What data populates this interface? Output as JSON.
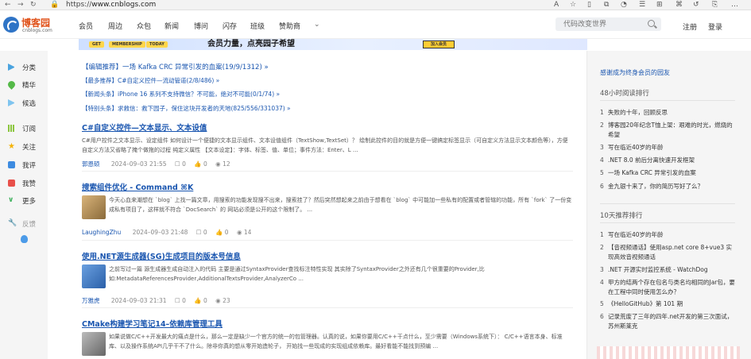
{
  "browser": {
    "url_scheme": "https://",
    "url_domain": "www.cnblogs.com"
  },
  "site": {
    "logo_name": "博客园",
    "logo_domain": "cnblogs.com",
    "nav": [
      "会员",
      "周边",
      "众包",
      "新闻",
      "博问",
      "闪存",
      "班级",
      "赞助商"
    ],
    "search_placeholder": "代码改变世界",
    "register": "注册",
    "login": "登录"
  },
  "banner": {
    "pills": [
      "GET",
      "MEMBERSHIP",
      "TODAY"
    ],
    "headline": "会员力量，点亮园子希望",
    "join": "加入会员"
  },
  "left_menu": [
    {
      "label": "分类",
      "icon": "triangle-play-icon"
    },
    {
      "label": "精华",
      "icon": "heart-icon"
    },
    {
      "label": "候选",
      "icon": "triangle-play-icon"
    },
    {
      "label": "订阅",
      "icon": "books-icon"
    },
    {
      "label": "关注",
      "icon": "star-icon"
    },
    {
      "label": "我评",
      "icon": "comment-icon"
    },
    {
      "label": "我赞",
      "icon": "thumbs-up-icon"
    },
    {
      "label": "更多",
      "icon": "chevron-down-icon"
    },
    {
      "label": "反馈",
      "icon": "wrench-icon"
    }
  ],
  "notices": [
    "【编辑推荐】一场 Kafka CRC 异常引发的血案(19/9/1312) »",
    "【最多推荐】C#自定义控件—流动管道(2/8/486) »",
    "【新闻头条】iPhone 16 系列不支持微信？不可能，绝对不可能(0/1/74) »",
    "【特别头条】求救信：救下园子，保住这块开发者的天地(825/556/331037) »"
  ],
  "posts": [
    {
      "title": "C#自定义控件—文本显示、文本设值",
      "summary": "C#用户控件之文本显示、设定组件 如何设计一个便捷的文本显示组件、文本设值组件（TextShow,TextSet）？ 绘制此控件的目的就是方便一键搞定标签显示（可自定义方法显示文本颜色等），方便自定义方法又省略了掩个做拖的过程 纯定义属性 【文本设定】：字体、标签、值、单位；事件方法：Enter、L ...",
      "author": "郭恩硕",
      "date": "2024–09–03 21:55",
      "comments": "0",
      "likes": "0",
      "views": "12",
      "thumb": false
    },
    {
      "title": "搜索组件优化 - Command ⌘K",
      "summary": "今天心血来潮想在 `blog` 上找一篇文章，用搜索的功能发现搜不出来，搜索挂了？然后突然想起来之前由于想看在 `blog` 中可能加一些私有的配置或者管辖的功能，所有 `fork` 了一份变成私有项目了，这样就不符合 `DocSearch` 的 网站必须是公开的这个限制了。 ...",
      "author": "LaughingZhu",
      "date": "2024–09–03 21:48",
      "comments": "0",
      "likes": "0",
      "views": "14",
      "thumb": true,
      "thumb_color": "#c9a46a"
    },
    {
      "title": "使用.NET源生成器(SG)生成项目的版本号信息",
      "summary": "之前写过一篇 源生成器生成自动注入的代码 主要是通过SyntaxProvider查找标注特性实现 其实除了SyntaxProvider之外还有几个很重要的Provider,比如:MetadataReferencesProvider,AdditionalTextsProvider,AnalyzerCo ...",
      "author": "万雅虎",
      "date": "2024–09–03 21:31",
      "comments": "0",
      "likes": "0",
      "views": "23",
      "thumb": true,
      "thumb_color": "#4a7fc0"
    },
    {
      "title": "CMake构建学习笔记14–依赖库管理工具",
      "summary": "如果说做C/C++开发最大的痛点是什么，那么一定是缺少一个官方的统一的包管理器。认真的说，如果你要用C/C++干点什么，至少需要（Windows系统下）： C/C++语言本身、标准库、以及操作系统API几乎干不了什么。除非你真的想从零开始造轮子， 开始找一些现成的实现组成依赖库。最好看能不能找到预编 ...",
      "author": "",
      "date": "",
      "comments": "",
      "likes": "",
      "views": "",
      "thumb": true,
      "thumb_color": "#8a8a8a"
    }
  ],
  "right_sidebar": {
    "member_link": "感谢成为终身会员的园友",
    "hot48_title": "48小时阅读排行",
    "hot48": [
      "失败的十年，回顾反思",
      "博客园20年纪念T恤上架：艰难的时光，燃烧的希望",
      "写在临近40岁的年龄",
      ".NET 8.0 前后分离快速开发框架",
      "一场 Kafka CRC 异常引发的血案",
      "金九银十来了，你的简历写好了么？"
    ],
    "top10_title": "10天推荐排行",
    "top10": [
      "写在临近40岁的年龄",
      "【音视频通话】使用asp.net core 8+vue3 实现高效音视频通话",
      ".NET 开源实时监控系统 - WatchDog",
      "甲方的结两个存在包名与类名均相同的Jar包，要在工程中同时使用怎么办？",
      "《HelloGitHub》第 101 期",
      "记录荒废了三年的四年.net开发的第三次面试，苏州斯莱克"
    ]
  },
  "icons": {
    "accent_blue": "#1a56b0",
    "logo_orange": "#e0531c"
  }
}
